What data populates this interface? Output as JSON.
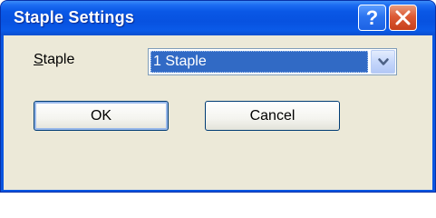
{
  "window": {
    "title": "Staple Settings"
  },
  "titlebar_buttons": {
    "help_glyph": "?",
    "help_icon": "help-icon",
    "close_icon": "close-icon"
  },
  "form": {
    "staple_label_accel": "S",
    "staple_label_rest": "taple",
    "staple_select_value": "1 Staple",
    "dropdown_icon": "chevron-down-icon"
  },
  "buttons": {
    "ok": "OK",
    "cancel": "Cancel"
  },
  "colors": {
    "titlebar": "#0a58e6",
    "close_button": "#dc5a34",
    "selection": "#316ac5",
    "dialog_face": "#ece9d8"
  }
}
